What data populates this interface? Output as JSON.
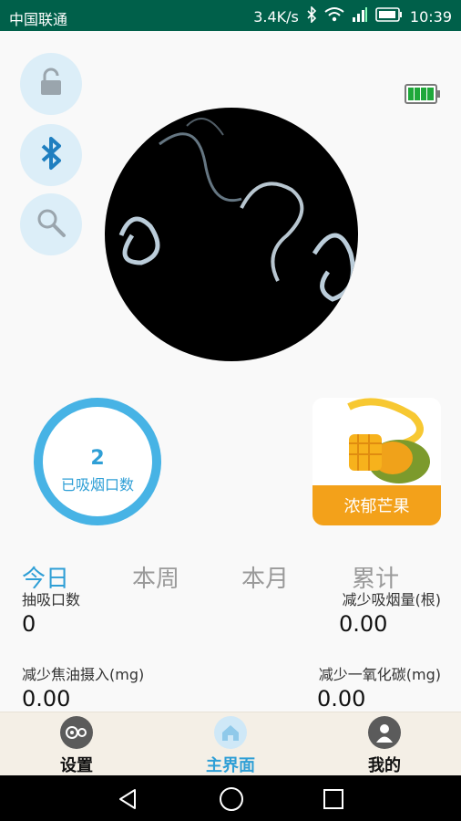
{
  "status_bar": {
    "carrier": "中国联通",
    "speed": "3.4K/s",
    "time": "10:39",
    "icons": [
      "bluetooth-icon",
      "wifi-icon",
      "signal-icon",
      "battery-icon"
    ]
  },
  "side_buttons": [
    "lock-icon",
    "bluetooth-icon",
    "search-icon"
  ],
  "device_battery": "battery-full-icon",
  "puff_counter": {
    "count": "2",
    "label": "已吸烟口数"
  },
  "flavor": {
    "name": "浓郁芒果"
  },
  "tabs": [
    {
      "label": "今日",
      "active": true
    },
    {
      "label": "本周",
      "active": false
    },
    {
      "label": "本月",
      "active": false
    },
    {
      "label": "累计",
      "active": false
    }
  ],
  "stats": {
    "puffs": {
      "label": "抽吸口数",
      "value": "0"
    },
    "cigs_reduced": {
      "label": "减少吸烟量(根)",
      "value": "0.00"
    },
    "tar_reduced": {
      "label": "减少焦油摄入(mg)",
      "value": "0.00"
    },
    "co_reduced": {
      "label": "减少一氧化碳(mg)",
      "value": "0.00"
    }
  },
  "bottom_nav": [
    {
      "label": "设置",
      "icon": "gear-icon",
      "active": false
    },
    {
      "label": "主界面",
      "icon": "home-icon",
      "active": true
    },
    {
      "label": "我的",
      "icon": "user-icon",
      "active": false
    }
  ],
  "colors": {
    "accent": "#2f9fd6",
    "status_bar": "#00604a",
    "flavor": "#f3a11a"
  }
}
